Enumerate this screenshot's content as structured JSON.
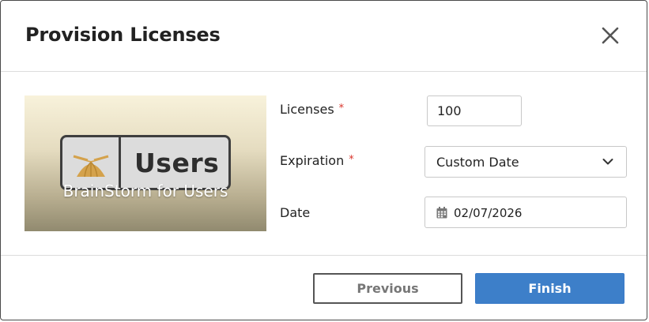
{
  "dialog": {
    "title": "Provision Licenses",
    "close_icon": "close-icon"
  },
  "product": {
    "badge_word": "Users",
    "caption": "BrainStorm for Users",
    "logo_icon": "brainstorm-logo-icon"
  },
  "form": {
    "licenses": {
      "label": "Licenses",
      "required_mark": "*",
      "value": "100"
    },
    "expiration": {
      "label": "Expiration",
      "required_mark": "*",
      "selected": "Custom Date",
      "icon": "chevron-down-icon"
    },
    "date": {
      "label": "Date",
      "value": "02/07/2026",
      "icon": "calendar-icon"
    }
  },
  "footer": {
    "previous_label": "Previous",
    "finish_label": "Finish"
  },
  "colors": {
    "primary": "#3d7fc9",
    "required": "#d9342b",
    "border": "#c8c8c8"
  }
}
